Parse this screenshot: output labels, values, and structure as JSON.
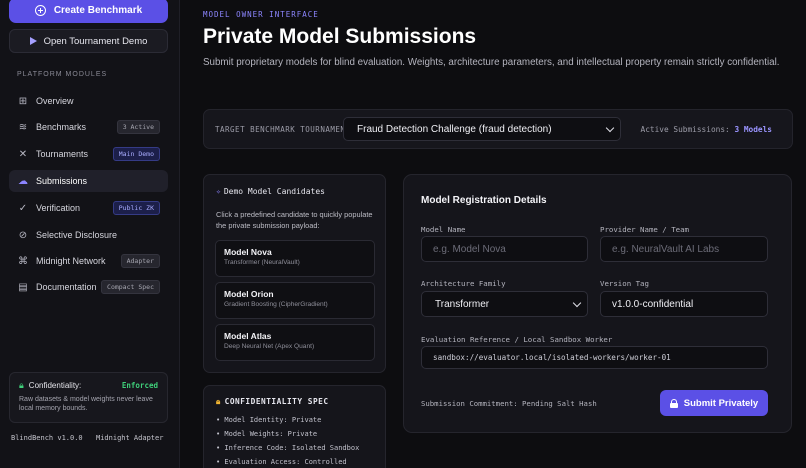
{
  "sidebar": {
    "create_label": "Create Benchmark",
    "demo_label": "Open Tournament Demo",
    "modules_label": "PLATFORM MODULES",
    "items": [
      {
        "label": "Overview",
        "icon": "grid-icon"
      },
      {
        "label": "Benchmarks",
        "icon": "layers-icon",
        "badge": "3 Active"
      },
      {
        "label": "Tournaments",
        "icon": "swords-icon",
        "badge": "Main Demo"
      },
      {
        "label": "Submissions",
        "icon": "cloud-upload-icon"
      },
      {
        "label": "Verification",
        "icon": "check-icon",
        "badge": "Public ZK"
      },
      {
        "label": "Selective Disclosure",
        "icon": "eye-off-icon"
      },
      {
        "label": "Midnight Network",
        "icon": "network-icon",
        "badge": "Adapter"
      },
      {
        "label": "Documentation",
        "icon": "book-icon",
        "badge": "Compact Spec"
      }
    ],
    "confidentiality": {
      "label": "Confidentiality:",
      "status": "Enforced",
      "text": "Raw datasets & model weights never leave local memory bounds."
    },
    "footer_left": "BlindBench v1.0.0",
    "footer_right": "Midnight Adapter"
  },
  "header": {
    "kicker": "MODEL OWNER INTERFACE",
    "title": "Private Model Submissions",
    "subtitle": "Submit proprietary models for blind evaluation. Weights, architecture parameters, and intellectual property remain strictly confidential."
  },
  "target": {
    "label": "TARGET BENCHMARK TOURNAMENT",
    "selected": "Fraud Detection Challenge (fraud detection)",
    "active_label": "Active Submissions:",
    "active_value": "3 Models"
  },
  "candidates": {
    "title": "Demo Model Candidates",
    "description": "Click a predefined candidate to quickly populate the private submission payload:",
    "items": [
      {
        "name": "Model Nova",
        "sub": "Transformer (NeuralVault)"
      },
      {
        "name": "Model Orion",
        "sub": "Gradient Boosting (CipherGradient)"
      },
      {
        "name": "Model Atlas",
        "sub": "Deep Neural Net (Apex Quant)"
      }
    ]
  },
  "spec": {
    "title": "CONFIDENTIALITY SPEC",
    "items": [
      "• Model Identity: Private",
      "• Model Weights: Private",
      "• Inference Code: Isolated Sandbox",
      "• Evaluation Access: Controlled"
    ]
  },
  "registration": {
    "title": "Model Registration Details",
    "model_name_label": "Model Name",
    "model_name_placeholder": "e.g. Model Nova",
    "provider_label": "Provider Name / Team",
    "provider_placeholder": "e.g. NeuralVault AI Labs",
    "arch_label": "Architecture Family",
    "arch_value": "Transformer",
    "version_label": "Version Tag",
    "version_value": "v1.0.0-confidential",
    "eval_label": "Evaluation Reference / Local Sandbox Worker",
    "eval_value": "sandbox://evaluator.local/isolated-workers/worker-01",
    "commitment": "Submission Commitment: Pending Salt Hash",
    "submit_label": "Submit Privately"
  },
  "colors": {
    "accent": "#5b50e6",
    "enforced": "#3fd07a",
    "lock": "#f0b432"
  }
}
